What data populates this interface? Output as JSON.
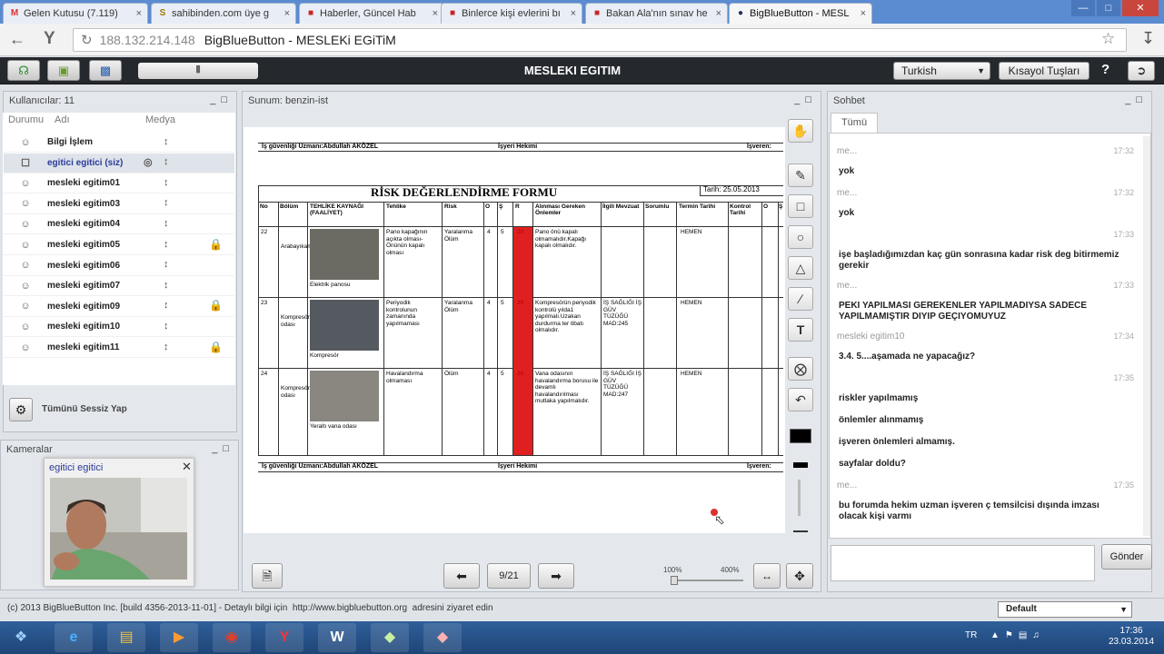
{
  "browser": {
    "tabs": [
      {
        "icon": "gmail-icon",
        "label": "Gelen Kutusu (7.119)"
      },
      {
        "icon": "sahibinden-icon",
        "label": "sahibinden.com üye g"
      },
      {
        "icon": "news-icon",
        "label": "Haberler, Güncel Hab"
      },
      {
        "icon": "news-icon",
        "label": "Binlerce kişi evlerini bı"
      },
      {
        "icon": "news-icon",
        "label": "Bakan Ala'nın sınav he"
      },
      {
        "icon": "bbb-icon",
        "label": "BigBlueButton - MESL"
      }
    ],
    "url_host": "188.132.214.148",
    "url_title": "BigBlueButton - MESLEKi EGiTiM"
  },
  "bbb": {
    "title": "MESLEKI EGITIM",
    "language": "Turkish",
    "shortcuts_label": "Kısayol Tuşları",
    "help_label": "?"
  },
  "users": {
    "title": "Kullanıcılar: 11",
    "col_status": "Durumu",
    "col_name": "Adı",
    "col_media": "Medya",
    "list": [
      {
        "name": "Bilgi İşlem",
        "selected": false,
        "lock": false,
        "cam": false
      },
      {
        "name": "egitici egitici (siz)",
        "selected": true,
        "lock": false,
        "cam": true
      },
      {
        "name": "mesleki egitim01",
        "selected": false,
        "lock": false,
        "cam": false
      },
      {
        "name": "mesleki egitim03",
        "selected": false,
        "lock": false,
        "cam": false
      },
      {
        "name": "mesleki egitim04",
        "selected": false,
        "lock": false,
        "cam": false
      },
      {
        "name": "mesleki egitim05",
        "selected": false,
        "lock": true,
        "cam": false
      },
      {
        "name": "mesleki egitim06",
        "selected": false,
        "lock": false,
        "cam": false
      },
      {
        "name": "mesleki egitim07",
        "selected": false,
        "lock": false,
        "cam": false
      },
      {
        "name": "mesleki egitim09",
        "selected": false,
        "lock": true,
        "cam": false
      },
      {
        "name": "mesleki egitim10",
        "selected": false,
        "lock": false,
        "cam": false
      },
      {
        "name": "mesleki egitim11",
        "selected": false,
        "lock": true,
        "cam": false
      }
    ],
    "mute_all": "Tümünü Sessiz Yap"
  },
  "cameras": {
    "title": "Kameralar",
    "window_name": "egitici egitici"
  },
  "presentation": {
    "title": "Sunum: benzin-ist",
    "page": "9/21",
    "zoom_min": "100%",
    "zoom_max": "400%",
    "zoom_fraction": 0.0
  },
  "form": {
    "top_left": "İş güvenliği Uzmanı:Abdullah AKÖZEL",
    "top_mid": "İşyeri Hekimi",
    "top_right": "İşveren:",
    "title": "RİSK DEĞERLENDİRME FORMU",
    "date": "Tarih: 25.05.2013",
    "headers": [
      "No",
      "Bölüm",
      "TEHLİKE KAYNAĞI (FAALİYET)",
      "Tehlike",
      "Risk",
      "O",
      "Ş",
      "R",
      "Alınması Gereken Önlemler",
      "İlgili Mevzuat",
      "Sorumlu",
      "Termin Tarihi",
      "Kontrol Tarihi",
      "O",
      "Ş"
    ],
    "rows": [
      {
        "no": "22",
        "bolum": "Arabayıkama",
        "caption": "Elektrik panosu",
        "tehlike": "Pano kapağının açıkta olması-Önünün kapalı olması",
        "risk": "Yaralanma Ölüm",
        "o": "4",
        "s": "5",
        "r": "20",
        "onlem": "Pano önü kapalı olmamalıdır.Kapağı kapalı olmalıdır.",
        "mevzuat": "",
        "termin": "HEMEN"
      },
      {
        "no": "23",
        "bolum": "Kompresör odası",
        "caption": "Kompresör",
        "tehlike": "Periyodik kontrolunun zamanında yapılmaması",
        "risk": "Yaralanma Ölüm",
        "o": "4",
        "s": "5",
        "r": "20",
        "onlem": "Kompresörün periyodik kontrolü yılda1 yapılmalı.Uzakan durdurma ter tibatı olmalıdır.",
        "mevzuat": "İŞ SAĞLIĞI İŞ GÜV TÜZÜĞÜ MAD:245",
        "termin": "HEMEN"
      },
      {
        "no": "24",
        "bolum": "Kompresör odası",
        "caption": "Yeraltı vana odası",
        "tehlike": "Havalandırma olmaması",
        "risk": "Ölüm",
        "o": "4",
        "s": "5",
        "r": "20",
        "onlem": "Vana odasının havalandırma borusu ile devamlı havalandırılması mutlaka yapılmalıdır.",
        "mevzuat": "İŞ SAĞLIĞI İŞ GÜV TÜZÜĞÜ MAD:247",
        "termin": "HEMEN"
      }
    ],
    "bottom_left": "İş güvenliği Uzmanı:Abdullah AKÖZEL",
    "bottom_mid": "İşyeri Hekimi",
    "bottom_right": "İşveren:"
  },
  "chat": {
    "title": "Sohbet",
    "tab": "Tümü",
    "messages": [
      {
        "sender": "me...",
        "time": "17:32",
        "text": "yok"
      },
      {
        "sender": "me...",
        "time": "17:32",
        "text": "yok"
      },
      {
        "sender": "",
        "time": "17:33",
        "text": "işe başladığımızdan kaç gün sonrasına kadar risk deg bitirmemiz gerekir"
      },
      {
        "sender": "me...",
        "time": "17:33",
        "text": "PEKI YAPILMASI GEREKENLER YAPILMADIYSA SADECE YAPILMAMIŞTIR DIYIP GEÇIYOMUYUZ"
      },
      {
        "sender": "mesleki egitim10",
        "time": "17:34",
        "text": "3.4. 5....aşamada ne yapacağız?"
      },
      {
        "sender": "",
        "time": "17:35",
        "text": "riskler yapılmamış"
      },
      {
        "sender": "",
        "time": "",
        "text": "önlemler alınmamış"
      },
      {
        "sender": "",
        "time": "",
        "text": "işveren önlemleri almamış."
      },
      {
        "sender": "",
        "time": "",
        "text": "sayfalar doldu?"
      },
      {
        "sender": "me...",
        "time": "17:35",
        "text": "bu forumda hekim uzman işveren ç temsilcisi dışında imzası olacak kişi varmı"
      }
    ],
    "send_label": "Gönder"
  },
  "footer": {
    "copyright": "(c) 2013 BigBlueButton Inc. [build 4356-2013-11-01] - Detaylı bilgi için",
    "link": "http://www.bigbluebutton.org",
    "suffix": "adresini ziyaret edin",
    "layout": "Default"
  },
  "taskbar": {
    "lang": "TR",
    "time": "17:36",
    "date": "23.03.2014"
  }
}
